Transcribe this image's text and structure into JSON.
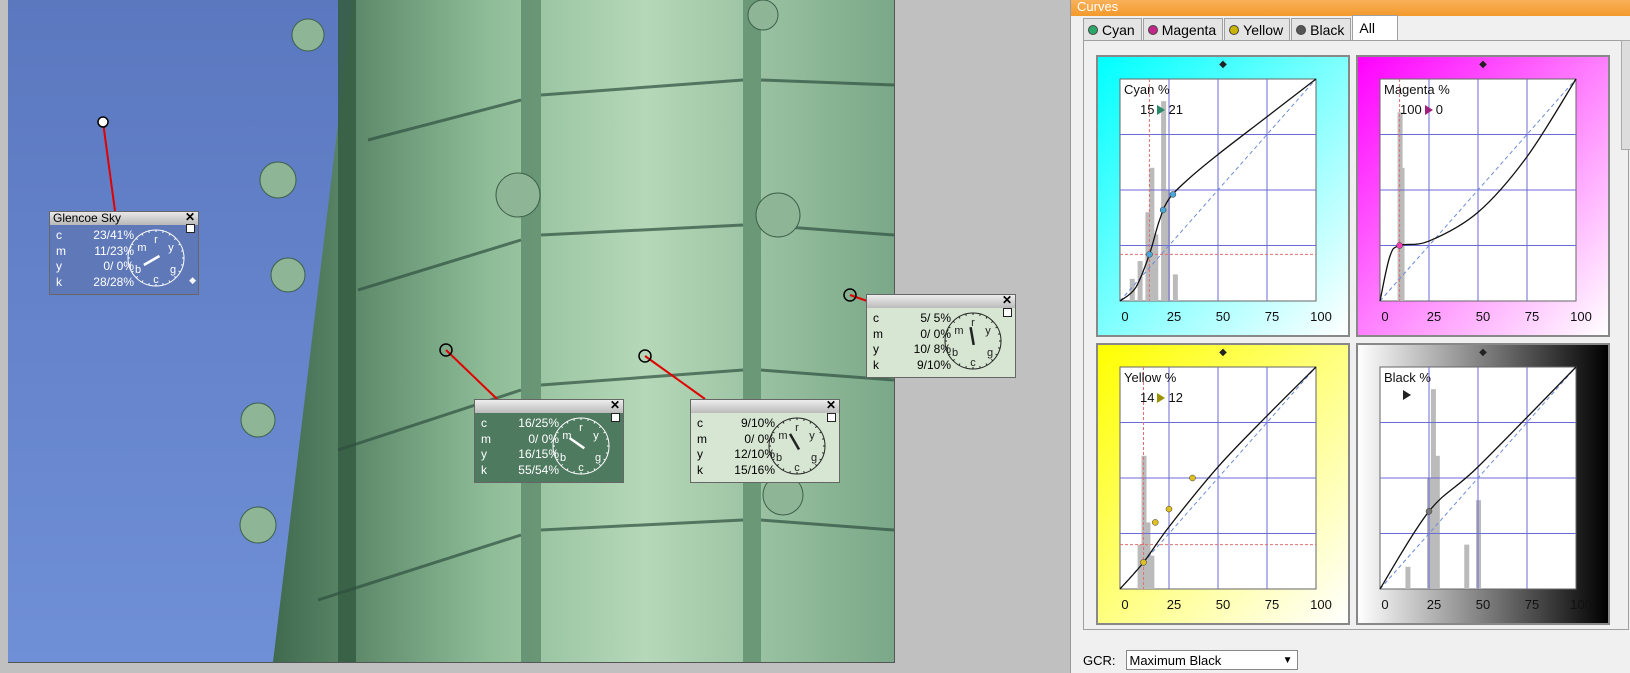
{
  "panel": {
    "title": "Curves"
  },
  "tabs": [
    {
      "label": "Cyan",
      "color": "#2aa86a"
    },
    {
      "label": "Magenta",
      "color": "#c2268a"
    },
    {
      "label": "Yellow",
      "color": "#c9b400"
    },
    {
      "label": "Black",
      "color": "#555555"
    },
    {
      "label": "All",
      "color": ""
    }
  ],
  "charts": {
    "cyan": {
      "label": "Cyan %",
      "in": "15",
      "out": "21",
      "ticks": [
        "0",
        "25",
        "50",
        "75",
        "100"
      ],
      "color": "#00ffff"
    },
    "magenta": {
      "label": "Magenta %",
      "in": "100",
      "out": "0",
      "ticks": [
        "0",
        "25",
        "50",
        "75",
        "100"
      ],
      "color": "#ff00ff"
    },
    "yellow": {
      "label": "Yellow %",
      "in": "14",
      "out": "12",
      "ticks": [
        "0",
        "25",
        "50",
        "75",
        "100"
      ],
      "color": "#ffff00"
    },
    "black": {
      "label": "Black %",
      "in": "",
      "out": "",
      "ticks": [
        "0",
        "25",
        "50",
        "75",
        "100"
      ],
      "color": "#000000"
    }
  },
  "gcr": {
    "label": "GCR:",
    "value": "Maximum Black"
  },
  "probes": {
    "sky": {
      "title": "Glencoe Sky",
      "rows": [
        [
          "c",
          "23/41%"
        ],
        [
          "m",
          "11/23%"
        ],
        [
          "y",
          "0/ 0%"
        ],
        [
          "k",
          "28/28%"
        ]
      ]
    },
    "p2": {
      "title": "",
      "rows": [
        [
          "c",
          "16/25%"
        ],
        [
          "m",
          "0/ 0%"
        ],
        [
          "y",
          "16/15%"
        ],
        [
          "k",
          "55/54%"
        ]
      ]
    },
    "p3": {
      "title": "",
      "rows": [
        [
          "c",
          "9/10%"
        ],
        [
          "m",
          "0/ 0%"
        ],
        [
          "y",
          "12/10%"
        ],
        [
          "k",
          "15/16%"
        ]
      ]
    },
    "p4": {
      "title": "",
      "rows": [
        [
          "c",
          "5/ 5%"
        ],
        [
          "m",
          "0/ 0%"
        ],
        [
          "y",
          "10/ 8%"
        ],
        [
          "k",
          "9/10%"
        ]
      ]
    }
  },
  "dial_letters": [
    "m",
    "r",
    "y",
    "b",
    "g",
    "c"
  ],
  "close_glyph": "✕"
}
